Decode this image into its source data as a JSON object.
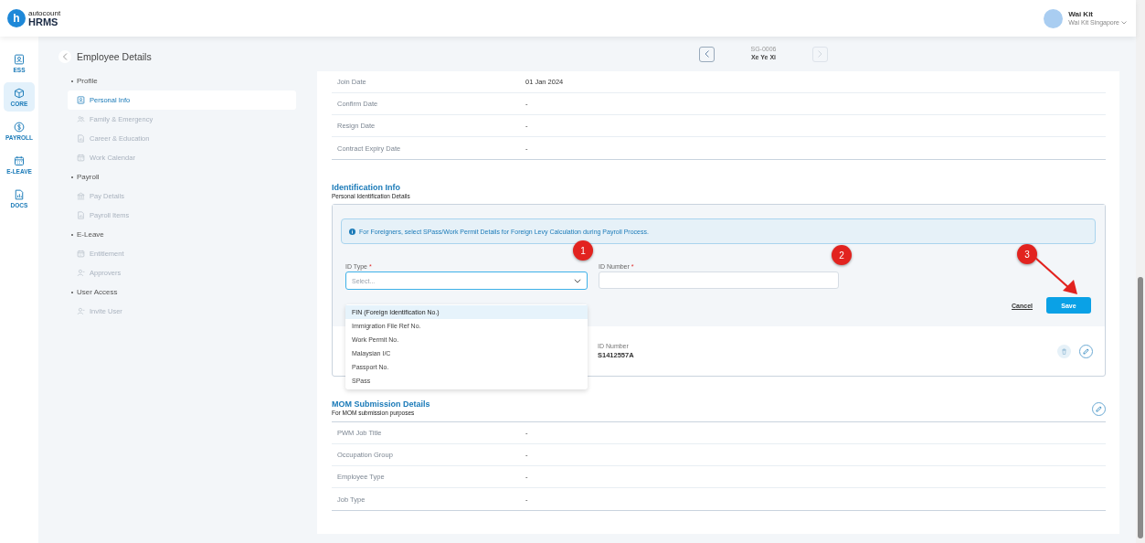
{
  "header": {
    "logo": {
      "mark": "h",
      "brand": "autocount",
      "product": "HRMS"
    },
    "user": {
      "name": "Wai Kit",
      "company": "Wai Kit Singapore"
    }
  },
  "rail": [
    {
      "label": "ESS",
      "kind": "badge",
      "selected": false
    },
    {
      "label": "CORE",
      "kind": "cube",
      "selected": true
    },
    {
      "label": "PAYROLL",
      "kind": "dollar",
      "selected": false
    },
    {
      "label": "E-LEAVE",
      "kind": "calendar",
      "selected": false
    },
    {
      "label": "DOCS",
      "kind": "doc",
      "selected": false
    }
  ],
  "nav": {
    "title": "Employee Details",
    "groups": [
      {
        "label": "Profile",
        "items": [
          {
            "label": "Personal Info",
            "kind": "badge",
            "selected": true
          },
          {
            "label": "Family & Emergency",
            "kind": "people",
            "selected": false
          },
          {
            "label": "Career & Education",
            "kind": "doc",
            "selected": false
          },
          {
            "label": "Work Calendar",
            "kind": "calendar",
            "selected": false
          }
        ]
      },
      {
        "label": "Payroll",
        "items": [
          {
            "label": "Pay Details",
            "kind": "bank",
            "selected": false
          },
          {
            "label": "Payroll Items",
            "kind": "doc",
            "selected": false
          }
        ]
      },
      {
        "label": "E-Leave",
        "items": [
          {
            "label": "Entitlement",
            "kind": "calendar",
            "selected": false
          },
          {
            "label": "Approvers",
            "kind": "person",
            "selected": false
          }
        ]
      },
      {
        "label": "User Access",
        "items": [
          {
            "label": "Invite User",
            "kind": "person",
            "selected": false
          }
        ]
      }
    ]
  },
  "pager": {
    "code": "SG-0006",
    "name": "Xe Ye Xi",
    "prev_disabled": false,
    "next_disabled": true
  },
  "employment_rows": [
    {
      "label": "Join Date",
      "value": "01 Jan 2024"
    },
    {
      "label": "Confirm Date",
      "value": "-"
    },
    {
      "label": "Resign Date",
      "value": "-"
    },
    {
      "label": "Contract Expiry Date",
      "value": "-"
    }
  ],
  "identification": {
    "title": "Identification Info",
    "subtitle": "Personal Identification Details",
    "alert": "For Foreigners, select SPass/Work Permit Details for Foreign Levy Calculation during Payroll Process.",
    "id_type": {
      "label": "ID Type",
      "required_mark": "*",
      "placeholder": "Select...",
      "expanded": true,
      "options": [
        {
          "label": "FIN (Foreign Identification No.)",
          "selected": true
        },
        {
          "label": "Immigration File Ref No.",
          "selected": false
        },
        {
          "label": "Work Permit No.",
          "selected": false
        },
        {
          "label": "Malaysian I/C",
          "selected": false
        },
        {
          "label": "Passport No.",
          "selected": false
        },
        {
          "label": "SPass",
          "selected": false
        }
      ]
    },
    "id_number": {
      "label": "ID Number",
      "required_mark": "*"
    },
    "cancel": "Cancel",
    "save": "Save",
    "record": {
      "label": "ID Number",
      "value": "S1412557A"
    }
  },
  "mom": {
    "title": "MOM Submission Details",
    "subtitle": "For MOM submission purposes",
    "rows": [
      {
        "label": "PWM Job Title",
        "value": "-"
      },
      {
        "label": "Occupation Group",
        "value": "-"
      },
      {
        "label": "Employee Type",
        "value": "-"
      },
      {
        "label": "Job Type",
        "value": "-"
      }
    ]
  },
  "annotations": [
    {
      "label": "1"
    },
    {
      "label": "2"
    },
    {
      "label": "3"
    }
  ]
}
